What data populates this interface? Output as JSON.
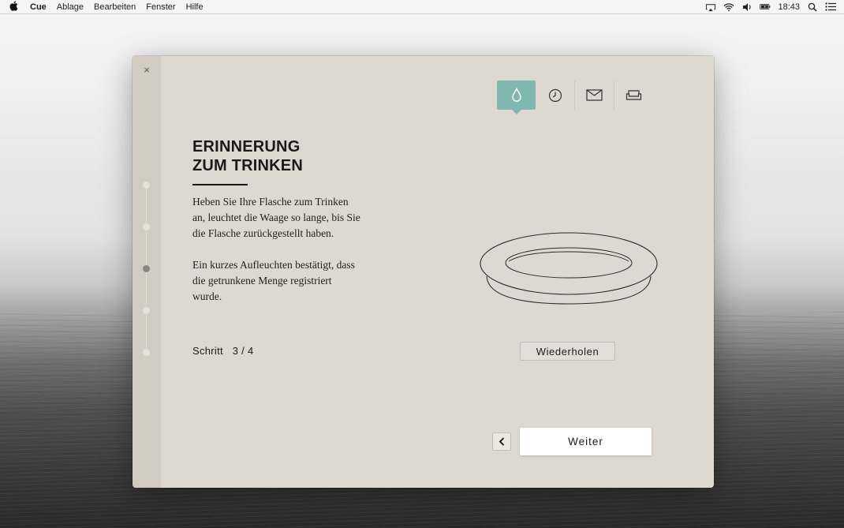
{
  "menubar": {
    "app_name": "Cue",
    "items": [
      "Ablage",
      "Bearbeiten",
      "Fenster",
      "Hilfe"
    ],
    "clock": "18:43",
    "icons": [
      "apple-icon",
      "airplay-icon",
      "wifi-icon",
      "volume-icon",
      "battery-icon",
      "spotlight-icon",
      "notification-center-icon"
    ]
  },
  "window": {
    "close_label": "×",
    "tabs": [
      {
        "name": "drop-icon",
        "active": true
      },
      {
        "name": "clock-icon",
        "active": false
      },
      {
        "name": "mail-icon",
        "active": false
      },
      {
        "name": "sofa-icon",
        "active": false
      }
    ],
    "steps": {
      "total": 5,
      "active_index": 2
    },
    "title_line1": "ERINNERUNG",
    "title_line2": "ZUM TRINKEN",
    "paragraph1": "Heben Sie Ihre Flasche zum Trinken an, leuchtet die Waage so lange, bis Sie die Flasche zurückgestellt haben.",
    "paragraph2": "Ein kurzes Aufleuchten bestätigt, dass die getrunkene Menge registriert wurde.",
    "step_prefix": "Schritt",
    "step_value": "3 / 4",
    "repeat_label": "Wiederholen",
    "next_label": "Weiter",
    "colors": {
      "accent": "#7fb8ae",
      "window_bg": "#ddd8d0",
      "rail_bg": "#d1cbc2"
    }
  }
}
